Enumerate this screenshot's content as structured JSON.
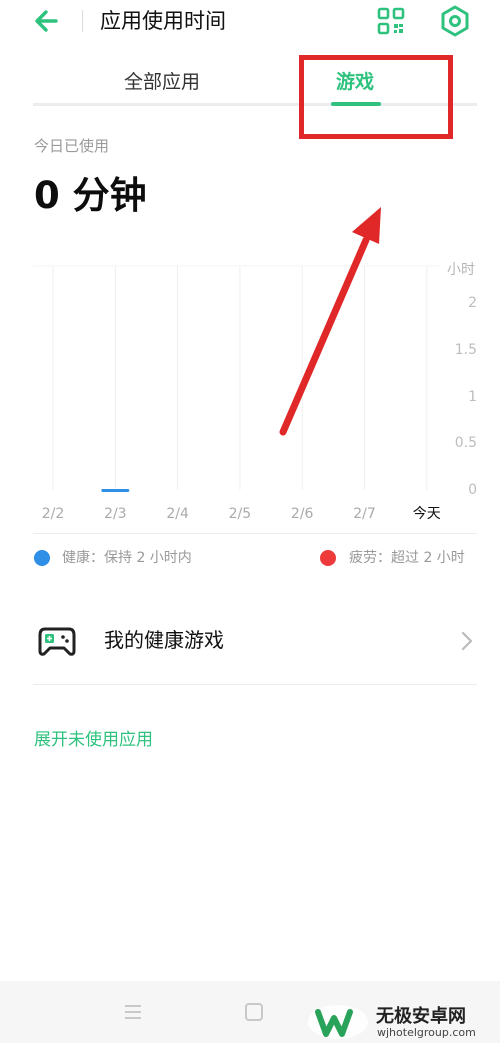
{
  "header": {
    "title": "应用使用时间",
    "back_icon": "arrow-left-icon",
    "qr_icon": "qr-code-icon",
    "settings_icon": "gear-icon"
  },
  "tabs": [
    {
      "label": "全部应用",
      "active": false
    },
    {
      "label": "游戏",
      "active": true
    }
  ],
  "usage": {
    "label": "今日已使用",
    "value": "0 分钟"
  },
  "chart_data": {
    "type": "bar",
    "categories": [
      "2/2",
      "2/3",
      "2/4",
      "2/5",
      "2/6",
      "2/7",
      "今天"
    ],
    "values": [
      0,
      0.02,
      0,
      0,
      0,
      0,
      0
    ],
    "ylabel": "小时",
    "yticks": [
      "2",
      "1.5",
      "1",
      "0.5",
      "0"
    ],
    "ylim": [
      0,
      2
    ],
    "grid": "vertical",
    "bar_color": "#2f8ee6"
  },
  "legend": {
    "healthy": "健康：保持 2 小时内",
    "tired": "疲劳：超过 2 小时",
    "healthy_color": "#2f8ee6",
    "tired_color": "#ee3a3a"
  },
  "list": {
    "healthy_games": "我的健康游戏"
  },
  "expand_link": "展开未使用应用",
  "colors": {
    "accent": "#2ec27e",
    "annotation": "#e12828"
  },
  "watermark": {
    "main": "无极安卓网",
    "sub": "wjhotelgroup.com"
  }
}
